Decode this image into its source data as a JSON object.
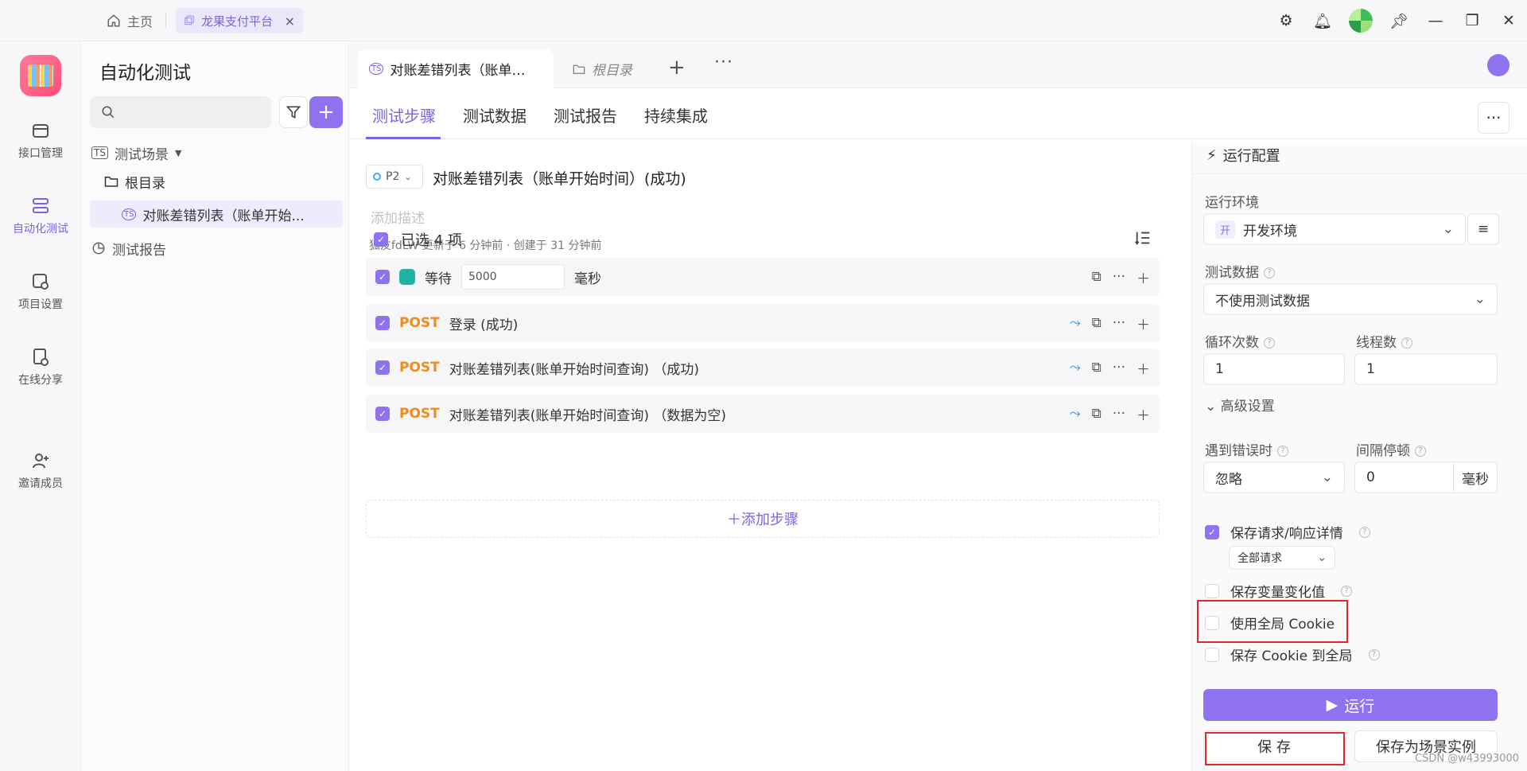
{
  "titlebar": {
    "home_label": "主页",
    "tab_label": "龙果支付平台",
    "close_glyph": "×"
  },
  "rail": {
    "items": [
      {
        "label": "接口管理"
      },
      {
        "label": "自动化测试"
      },
      {
        "label": "项目设置"
      },
      {
        "label": "在线分享"
      },
      {
        "label": "邀请成员"
      }
    ]
  },
  "tree": {
    "title": "自动化测试",
    "search_placeholder": "",
    "add_glyph": "+",
    "scene_root": "测试场景",
    "root_dir": "根目录",
    "selected_item": "对账差错列表（账单开始...",
    "report": "测试报告"
  },
  "doc_tabs": {
    "active": "对账差错列表（账单…",
    "other": "根目录",
    "plus": "+",
    "more": "···"
  },
  "sub_tabs": [
    "测试步骤",
    "测试数据",
    "测试报告",
    "持续集成"
  ],
  "scene": {
    "priority": "P2",
    "title": "对账差错列表（账单开始时间）(成功)",
    "desc_placeholder": "添加描述",
    "meta": "狐友fdLW 更新于 6 分钟前 · 创建于 31 分钟前",
    "selected_count": "已选 4 项"
  },
  "steps": [
    {
      "kind": "wait",
      "label": "等待",
      "value": "5000",
      "unit": "毫秒"
    },
    {
      "kind": "post",
      "method": "POST",
      "label": "登录 (成功)"
    },
    {
      "kind": "post",
      "method": "POST",
      "label": "对账差错列表(账单开始时间查询) （成功)"
    },
    {
      "kind": "post",
      "method": "POST",
      "label": "对账差错列表(账单开始时间查询) （数据为空)"
    }
  ],
  "add_step": "＋添加步骤",
  "config": {
    "title": "运行配置",
    "env_label": "运行环境",
    "env_tag": "开",
    "env_value": "开发环境",
    "testdata_label": "测试数据",
    "testdata_value": "不使用测试数据",
    "loop_label": "循环次数",
    "loop_value": "1",
    "thread_label": "线程数",
    "thread_value": "1",
    "advanced": "高级设置",
    "on_error_label": "遇到错误时",
    "on_error_value": "忽略",
    "interval_label": "间隔停顿",
    "interval_value": "0",
    "interval_unit": "毫秒",
    "save_detail": "保存请求/响应详情",
    "all_requests": "全部请求",
    "save_vars": "保存变量变化值",
    "use_global_cookie": "使用全局 Cookie",
    "save_cookie_global": "保存 Cookie 到全局",
    "run": "运行",
    "save": "保 存",
    "save_instance": "保存为场景实例"
  },
  "colors": {
    "accent": "#8e72ef",
    "post": "#f08b22",
    "highlight": "#e5252a"
  },
  "watermark": "CSDN @w43993000"
}
